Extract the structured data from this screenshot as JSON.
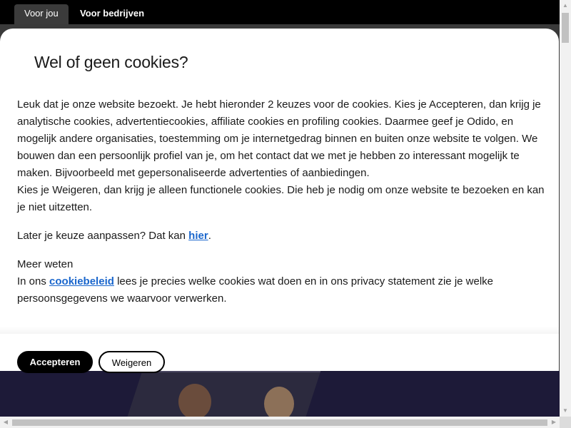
{
  "tabs": [
    {
      "label": "Voor jou"
    },
    {
      "label": "Voor bedrijven"
    }
  ],
  "modal": {
    "title": "Wel of geen cookies?",
    "paragraph1": "Leuk dat je onze website bezoekt. Je hebt hieronder 2 keuzes voor de cookies. Kies je Accepteren, dan krijg je analytische cookies, advertentiecookies, affiliate cookies en profiling cookies. Daarmee geef je Odido, en mogelijk andere organisaties, toestemming om je internetgedrag binnen en buiten onze website te volgen. We bouwen dan een persoonlijk profiel van je, om het contact dat we met je hebben zo interessant mogelijk te maken. Bijvoorbeeld met gepersonaliseerde advertenties of aanbiedingen.",
    "paragraph2": "Kies je Weigeren, dan krijg je alleen functionele cookies. Die heb je nodig om onze website te bezoeken en kan je niet uitzetten.",
    "later_prefix": "Later je keuze aanpassen? Dat kan ",
    "later_link": "hier",
    "later_suffix": ".",
    "more_heading": "Meer weten",
    "more_prefix": "In ons ",
    "more_link": "cookiebeleid",
    "more_suffix": " lees je precies welke cookies wat doen en in ons privacy statement zie je welke persoonsgegevens we waarvoor verwerken.",
    "accept_label": "Accepteren",
    "decline_label": "Weigeren"
  },
  "colors": {
    "link": "#1a66cc",
    "accept_bg": "#000000",
    "hero_bg": "#1d1a38"
  }
}
